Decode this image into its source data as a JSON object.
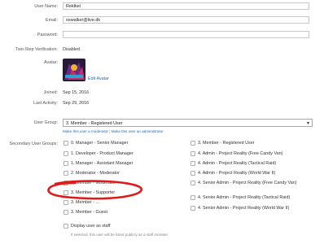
{
  "fields": {
    "user_name": {
      "label": "User Name:",
      "value": "Rektkel"
    },
    "email": {
      "label": "Email:",
      "value": "oswalker@live.dk"
    },
    "password": {
      "label": "Password:",
      "value": ""
    },
    "two_step": {
      "label": "Two-Step Verification:",
      "value": "Disabled"
    },
    "avatar": {
      "label": "Avatar:",
      "edit_link": "Edit Avatar"
    },
    "joined": {
      "label": "Joined:",
      "value": "Sep 15, 2016"
    },
    "last_activity": {
      "label": "Last Activity:",
      "value": "Sep 29, 2016"
    }
  },
  "user_group": {
    "label": "User Group:",
    "selected": "3. Member - Registered User",
    "link_moderator": "Make this user a moderator",
    "separator": "|",
    "link_admin": "Make this user an administrator"
  },
  "secondary_groups": {
    "label": "Secondary User Groups:",
    "left": [
      "0. Manager - Senior Manager",
      "1. Developer - Product Manager",
      "1. Manager - Assistant Manager",
      "2. Moderator - Moderator",
      "3. Member - Moderator",
      "3. Member - Supporter",
      "3. Member - ...",
      "3. Member - Guest"
    ],
    "right": [
      "3. Member - Registered User",
      "4. Admin - Project Reality (Free Candy Van)",
      "4. Admin - Project Reality (Tactical Raid)",
      "4. Admin - Project Reality (World War II)",
      "4. Senior Admin - Project Reality (Free Candy Van)",
      "4. Senior Admin - Project Reality (Tactical Raid)",
      "4. Senior Admin - Project Reality (World War II)"
    ],
    "display_staff": "Display user as staff",
    "display_staff_hint": "If selected, this user will be listed publicly as a staff member."
  },
  "colors": {
    "link": "#2a6db0",
    "annotation_circle": "#e01a1a"
  }
}
